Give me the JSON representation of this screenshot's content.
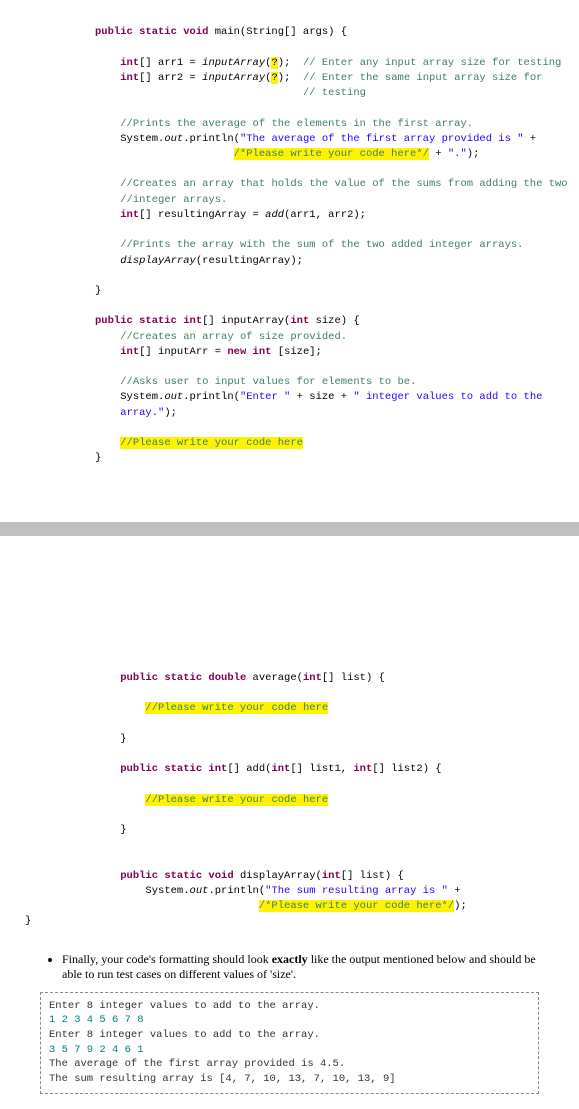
{
  "code_top": {
    "l1a": "public static void",
    "l1b": " main(String[] args) {",
    "l2a": "int",
    "l2b": "[] arr1 = ",
    "l2c": "inputArray",
    "l2d": "(",
    "l2e": "?",
    "l2f": ");  ",
    "l2g": "// Enter any input array size for testing",
    "l3a": "int",
    "l3b": "[] arr2 = ",
    "l3c": "inputArray",
    "l3d": "(",
    "l3e": "?",
    "l3f": ");  ",
    "l3g": "// Enter the same input array size for",
    "l4": "// testing",
    "l5": "//Prints the average of the elements in the first array.",
    "l6a": "System.",
    "l6b": "out",
    "l6c": ".println(",
    "l6d": "\"The average of the first array provided is \"",
    "l6e": " + ",
    "l7a": "/*Please write your code here*/",
    "l7b": " + ",
    "l7c": "\".\"",
    "l7d": ");",
    "l8": "//Creates an array that holds the value of the sums from adding the two",
    "l9": "//integer arrays.",
    "l10a": "int",
    "l10b": "[] resultingArray = ",
    "l10c": "add",
    "l10d": "(arr1, arr2);",
    "l11": "//Prints the array with the sum of the two added integer arrays.",
    "l12a": "displayArray",
    "l12b": "(resultingArray);",
    "l13": "}",
    "l14a": "public static int",
    "l14b": "[] inputArray(",
    "l14c": "int",
    "l14d": " size) {",
    "l15": "//Creates an array of size provided.",
    "l16a": "int",
    "l16b": "[] inputArr = ",
    "l16c": "new int",
    "l16d": " [size];",
    "l17": "//Asks user to input values for elements to be.",
    "l18a": "System.",
    "l18b": "out",
    "l18c": ".println(",
    "l18d": "\"Enter \"",
    "l18e": " + size + ",
    "l18f": "\" integer values to add to the",
    "l19a": "array.\"",
    "l19b": ");",
    "l20": "//Please write your code here",
    "l21": "}"
  },
  "code_bot": {
    "l1a": "public static double",
    "l1b": " average(",
    "l1c": "int",
    "l1d": "[] list) {",
    "l2": "//Please write your code here",
    "l3": "}",
    "l4a": "public static int",
    "l4b": "[] add(",
    "l4c": "int",
    "l4d": "[] list1, ",
    "l4e": "int",
    "l4f": "[] list2) {",
    "l5": "//Please write your code here",
    "l6": "}",
    "l7a": "public static void",
    "l7b": " displayArray(",
    "l7c": "int",
    "l7d": "[] list) {",
    "l8a": "System.",
    "l8b": "out",
    "l8c": ".println(",
    "l8d": "\"The sum resulting array is \"",
    "l8e": " + ",
    "l9a": "/*Please write your code here*/",
    "l9b": ");",
    "l10": "}"
  },
  "instr": {
    "li1a": "Finally, your code's formatting should look ",
    "li1b": "exactly",
    "li1c": " like the output mentioned below and should be able to run test cases on different values of 'size'."
  },
  "output": {
    "l1": "Enter 8 integer values to add to the array.",
    "l2": "1 2 3 4 5 6 7 8",
    "l3": "Enter 8 integer values to add to the array.",
    "l4": "3 5 7 9 2 4 6 1",
    "l5": "The average of the first array provided is 4.5.",
    "l6": "The sum resulting array is [4, 7, 10, 13, 7, 10, 13, 9]"
  }
}
